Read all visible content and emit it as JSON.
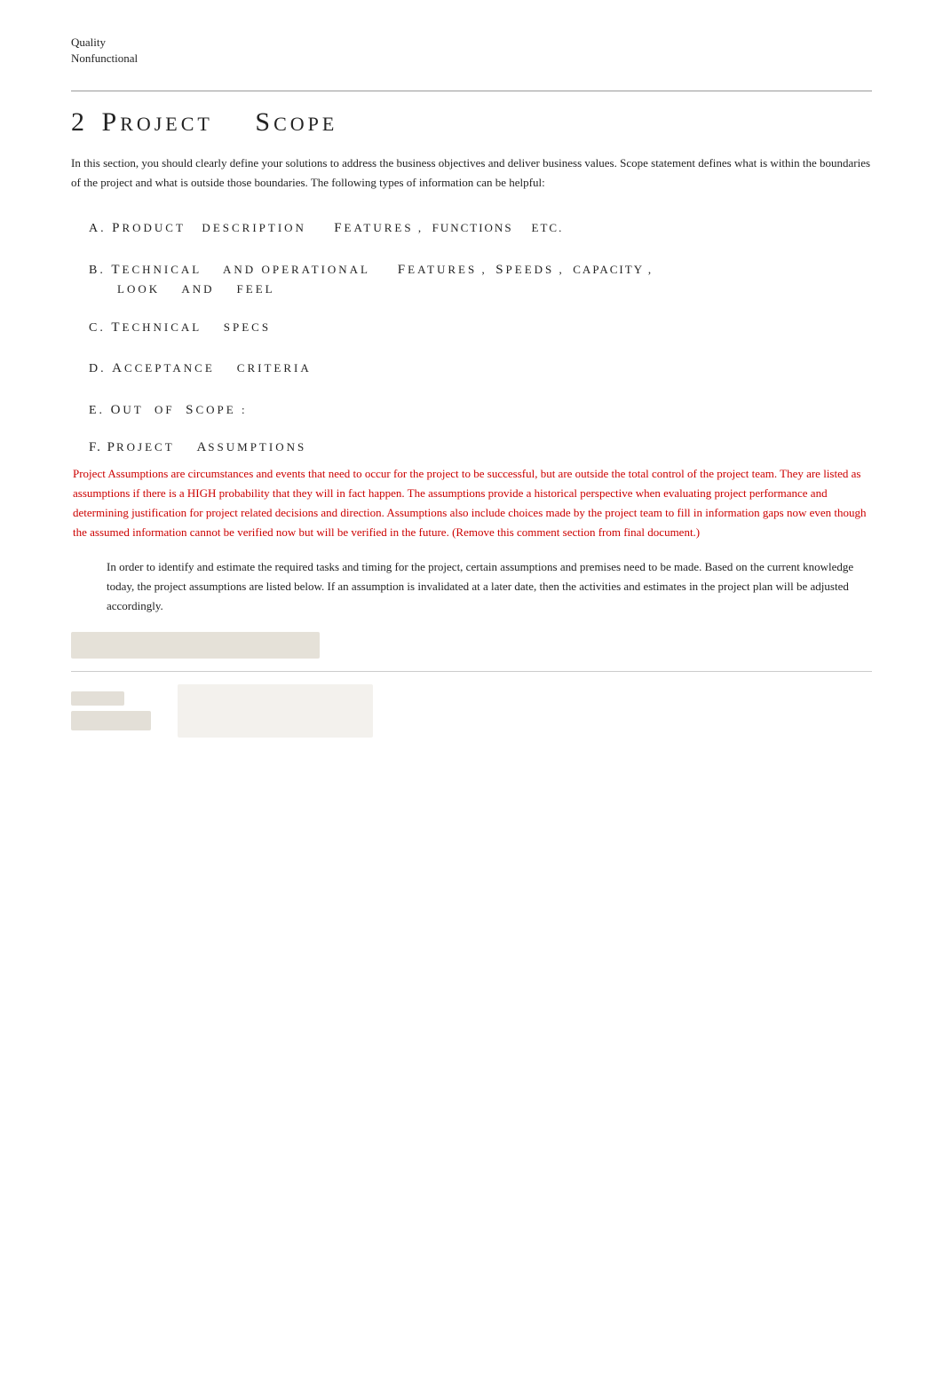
{
  "top_links": {
    "link1": "Quality",
    "link2": "Nonfunctional"
  },
  "section": {
    "number": "2",
    "title_word1": "P",
    "title_word1_rest": "ROJECT",
    "title_word2": "S",
    "title_word2_rest": "COPE"
  },
  "intro": {
    "text": "In this section, you should clearly define your solutions to address the business objectives and deliver business values.        Scope statement defines what is within the boundaries of the project and what is outside those boundaries. The following types of information can be helpful:"
  },
  "list_items": [
    {
      "id": "a",
      "label": "A. P",
      "label_rest": "RODUCT   DESCRIPTION",
      "features": "F",
      "features_rest": "EATURES",
      "suffix": ",   FUNCTIONS   ETC."
    },
    {
      "id": "b",
      "label": "B. T",
      "label_rest": "ECHNICAL   AND OPERATIONAL",
      "features": "F",
      "features_rest": "EATURES",
      "suffix": ", S",
      "suffix_rest": "PEEDS",
      "suffix2": ",  CAPACITY  ,",
      "line2": "LOOK   AND   FEEL"
    },
    {
      "id": "c",
      "label": "C. T",
      "label_rest": "ECHNICAL   SPECS"
    },
    {
      "id": "d",
      "label": "D. A",
      "label_rest": "CCEPTANCE   CRITERIA"
    },
    {
      "id": "e",
      "label": "E. O",
      "label_rest": "UT  OF",
      "s_word": "S",
      "s_rest": "COPE",
      "colon": ":"
    }
  ],
  "subsection_f": {
    "letter": "F.",
    "title_word1": "P",
    "title_word1_rest": "ROJECT",
    "title_word2": "A",
    "title_word2_rest": "SSUMPTIONS"
  },
  "comment": {
    "text": "Project Assumptions are circumstances and events that need to occur for the project to be successful, but are outside the total control of the project team. They are listed as assumptions if there is a HIGH probability that they will in fact happen. The assumptions provide a historical perspective when evaluating project performance and determining justification for project related decisions and direction. Assumptions also include choices made by the project team to fill in information gaps now even though the assumed information cannot be verified now but will be verified in the future. (Remove this comment section from final document.)"
  },
  "indented_text": {
    "text": "In order to identify and estimate the required tasks and timing for the project, certain assumptions and premises need to be made.           Based on the current knowledge today, the project assumptions are listed below.            If an assumption is invalidated at a later date, then the activities and estimates in the project plan will be adjusted accordingly."
  }
}
